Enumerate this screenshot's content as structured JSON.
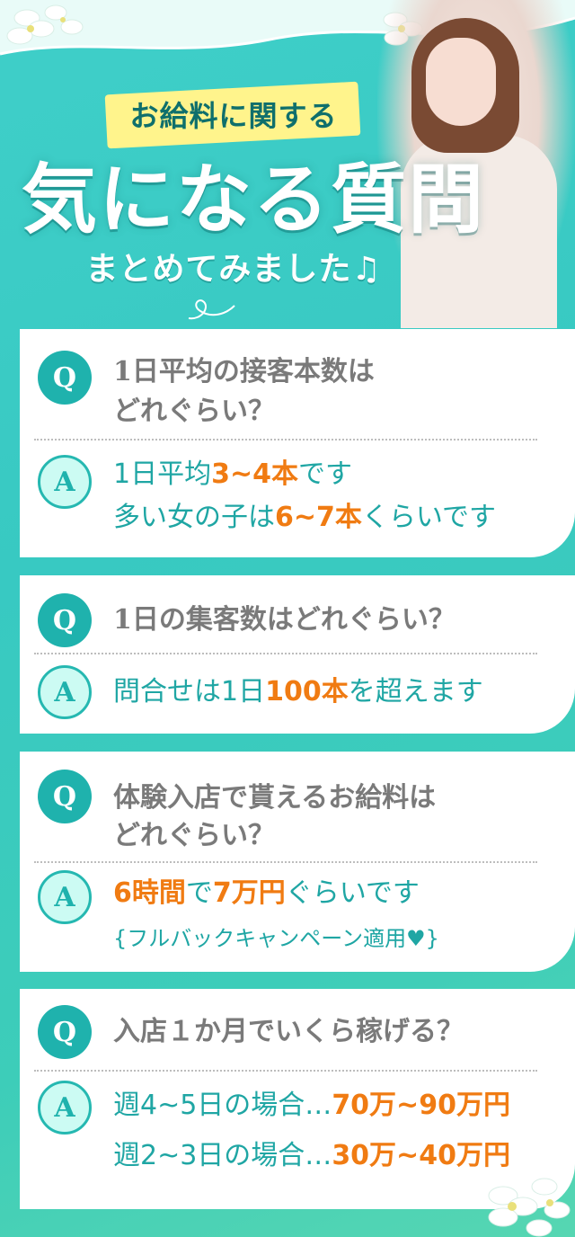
{
  "header": {
    "line1": "お給料に関する",
    "line2": "気になる質問",
    "line3": "まとめてみました♫"
  },
  "badge_q": "Q",
  "badge_a": "A",
  "faq": [
    {
      "q1": "1日平均の接客本数は",
      "q2": "どれぐらい？",
      "a1_pre": "1日平均",
      "a1_hi": "3~4本",
      "a1_post": "です",
      "a2_pre": "多い女の子は",
      "a2_hi": "6~7本",
      "a2_post": "くらいです"
    },
    {
      "q1": "1日の集客数はどれぐらい？",
      "a1_pre": "問合せは1日",
      "a1_hi": "100本",
      "a1_post": "を超えます"
    },
    {
      "q1": "体験入店で貰えるお給料は",
      "q2": "どれぐらい？",
      "a1_hi": "6時間",
      "a1_mid": "で",
      "a1_hi2": "7万円",
      "a1_post": "ぐらいです",
      "a2": "{フルバックキャンペーン適用",
      "a2_heart": "♥",
      "a2_end": "}"
    },
    {
      "q1": "入店１か月でいくら稼げる？",
      "a1_pre": "週4~5日の場合…",
      "a1_hi": "70万~90万円",
      "a2_pre": "週2~3日の場合…",
      "a2_hi": "30万~40万円"
    }
  ],
  "colors": {
    "accent": "#1fb2ad",
    "highlight": "#f07b12",
    "question_text": "#7a7a7a",
    "banner": "#fff48c"
  }
}
